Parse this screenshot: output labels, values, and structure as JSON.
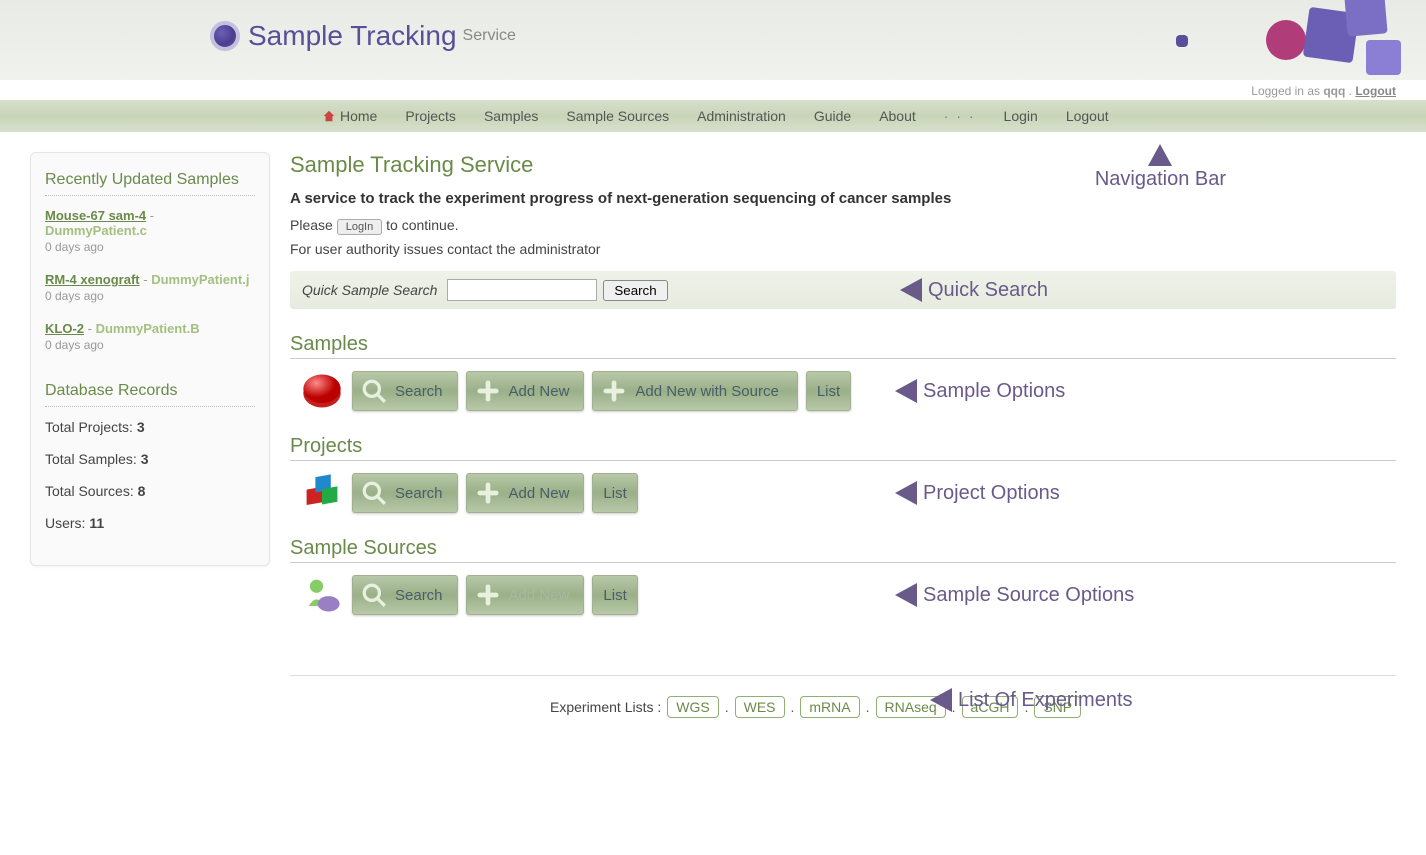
{
  "header": {
    "title_main": "Sample Tracking",
    "title_sub": "Service"
  },
  "login_bar": {
    "prefix": "Logged in as ",
    "user": "qqq",
    "sep": " . ",
    "logout": "Logout"
  },
  "nav": {
    "items": [
      "Home",
      "Projects",
      "Samples",
      "Sample Sources",
      "Administration",
      "Guide",
      "About"
    ],
    "dots": "· · ·",
    "login": "Login",
    "logout": "Logout"
  },
  "annot": {
    "nav": "Navigation Bar",
    "quick": "Quick Search",
    "samples": "Sample Options",
    "projects": "Project Options",
    "sources": "Sample Source Options",
    "experiments": "List Of Experiments"
  },
  "sidebar": {
    "recent_title": "Recently Updated Samples",
    "recent": [
      {
        "name": "Mouse-67 sam-4",
        "sep": " - ",
        "src": "DummyPatient.c",
        "age": "0 days ago"
      },
      {
        "name": "RM-4 xenograft",
        "sep": " - ",
        "src": "DummyPatient.j",
        "age": "0 days ago"
      },
      {
        "name": "KLO-2",
        "sep": " - ",
        "src": "DummyPatient.B",
        "age": "0 days ago"
      }
    ],
    "db_title": "Database Records",
    "db": [
      {
        "label": "Total Projects: ",
        "value": "3"
      },
      {
        "label": "Total Samples: ",
        "value": "3"
      },
      {
        "label": "Total Sources: ",
        "value": "8"
      },
      {
        "label": "Users: ",
        "value": "11"
      }
    ]
  },
  "main": {
    "title": "Sample Tracking Service",
    "subtitle": "A service to track the experiment progress of next-generation sequencing of cancer samples",
    "please": "Please ",
    "login_btn": "LogIn",
    "to_continue": " to continue.",
    "auth_line": "For user authority issues contact the administrator",
    "quick_label": "Quick Sample Search",
    "quick_btn": "Search"
  },
  "sections": {
    "samples": {
      "title": "Samples",
      "search": "Search",
      "add": "Add New",
      "add_src": "Add New with Source",
      "list": "List"
    },
    "projects": {
      "title": "Projects",
      "search": "Search",
      "add": "Add New",
      "list": "List"
    },
    "sources": {
      "title": "Sample Sources",
      "search": "Search",
      "add": "Add New",
      "list": "List"
    }
  },
  "experiments": {
    "label": "Experiment Lists : ",
    "chips": [
      "WGS",
      "WES",
      "mRNA",
      "RNAseq",
      "aCGH",
      "SNP"
    ],
    "sep": "."
  }
}
